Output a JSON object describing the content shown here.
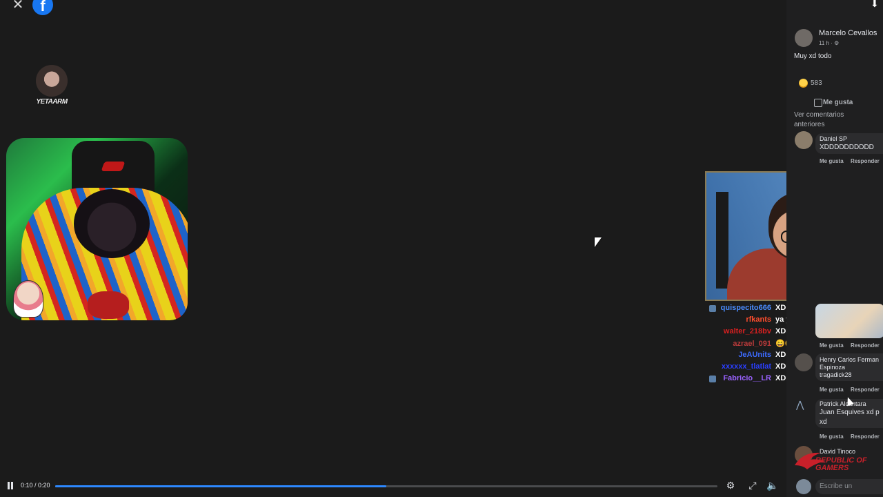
{
  "top": {
    "close_glyph": "✕",
    "logo_letter": "f"
  },
  "mini_avatar": {
    "tag": "YETAARM"
  },
  "chat": [
    {
      "name": "quispecito666",
      "msg": "XD",
      "color": "#4a8cff",
      "badge": true
    },
    {
      "name": "rfkants",
      "msg": "ya y?",
      "color": "#ff4d2e",
      "badge": false
    },
    {
      "name": "walter_218bv",
      "msg": "XDDD",
      "color": "#d82020",
      "badge": false
    },
    {
      "name": "azrael_091",
      "msg": "😄😄😄",
      "color": "#b83a3a",
      "badge": false
    },
    {
      "name": "JeAUnits",
      "msg": "XDDDDDD",
      "color": "#3d6bff",
      "badge": false
    },
    {
      "name": "xxxxxx_tlatlat",
      "msg": "XDD",
      "color": "#2a3fff",
      "badge": false
    },
    {
      "name": "Fabricio__LR",
      "msg": "XDDD",
      "color": "#9a62ff",
      "badge": true
    }
  ],
  "panel": {
    "post_author": "Marcelo Cevallos",
    "post_time": "11 h · ⚙",
    "post_text": "Muy xd todo",
    "reaction_count": "583",
    "like_label": "Me gusta",
    "older_comments": "Ver comentarios anteriores",
    "comments": [
      {
        "author": "Daniel SP",
        "text": "XDDDDDDDDDD"
      },
      {
        "author": "Henry Carlos Fernandez Espinoza",
        "author_line1": "Henry Carlos Ferman",
        "author_line2": "Espinoza",
        "text": "tragadick28"
      },
      {
        "author": "Patrick Alcántara",
        "author_display": "Patrick Alcántara",
        "text": "Juan Esquives xd p",
        "text2": "xd"
      },
      {
        "author": "David Tinoco",
        "text": ""
      }
    ],
    "action_like": "Me gusta",
    "action_reply": "Responder",
    "rog_text_1": "REPUBLIC OF",
    "rog_text_2": "GAMERS",
    "comment_placeholder": "Escribe un comentario..."
  },
  "player": {
    "time": "0:10 / 0:20",
    "progress": 0.5,
    "buffered": 0.48
  }
}
